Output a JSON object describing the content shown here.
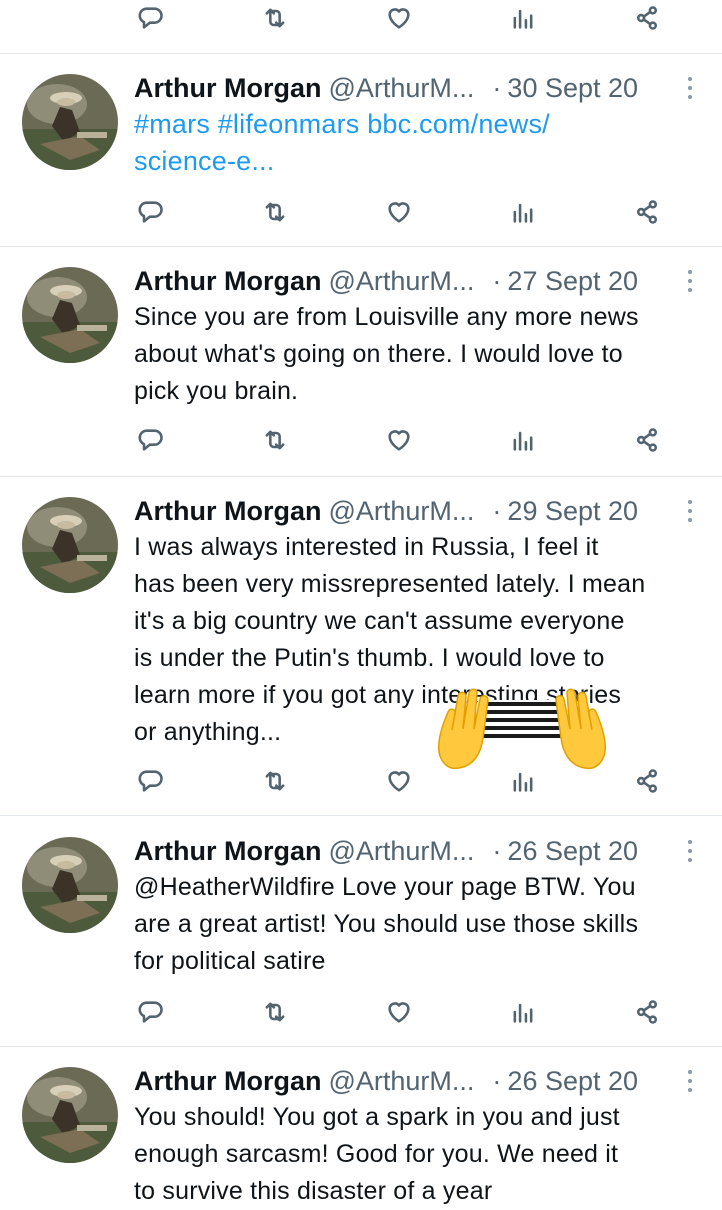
{
  "tweets": [
    {
      "name": "Arthur Morgan",
      "handle": "@ArthurM...",
      "separator": "·",
      "date": "30 Sept 20",
      "hashtags": "#mars #lifeonmars",
      "link_line1": "bbc.com/news/",
      "link_line2": "science-e..."
    },
    {
      "name": "Arthur Morgan",
      "handle": "@ArthurM...",
      "separator": "·",
      "date": "27 Sept 20",
      "lines": [
        "Since you are from Louisville any more news",
        "about what's going on there. I would love to",
        "pick you brain."
      ]
    },
    {
      "name": "Arthur Morgan",
      "handle": "@ArthurM...",
      "separator": "·",
      "date": "29 Sept 20",
      "lines": [
        "I was always interested in Russia, I feel it",
        "has been very missrepresented lately. I mean",
        "it's a big country we can't assume everyone",
        "is under the Putin's thumb. I would love to",
        "learn more if you got any interesting stories",
        "or anything..."
      ]
    },
    {
      "name": "Arthur Morgan",
      "handle": "@ArthurM...",
      "separator": "·",
      "date": "26 Sept 20",
      "lines": [
        "@HeatherWildfire Love your page BTW. You",
        "are a great artist! You should use those skills",
        "for political satire"
      ]
    },
    {
      "name": "Arthur Morgan",
      "handle": "@ArthurM...",
      "separator": "·",
      "date": "26 Sept 20",
      "lines": [
        "You should! You got a spark in you and just",
        "enough sarcasm! Good for you. We need it",
        "to survive this disaster of a year"
      ]
    }
  ],
  "icons": [
    "reply-icon",
    "retweet-icon",
    "like-icon",
    "views-icon",
    "share-icon"
  ],
  "colors": {
    "link": "#1d9bf0",
    "muted": "#536471",
    "text": "#0f1419"
  }
}
